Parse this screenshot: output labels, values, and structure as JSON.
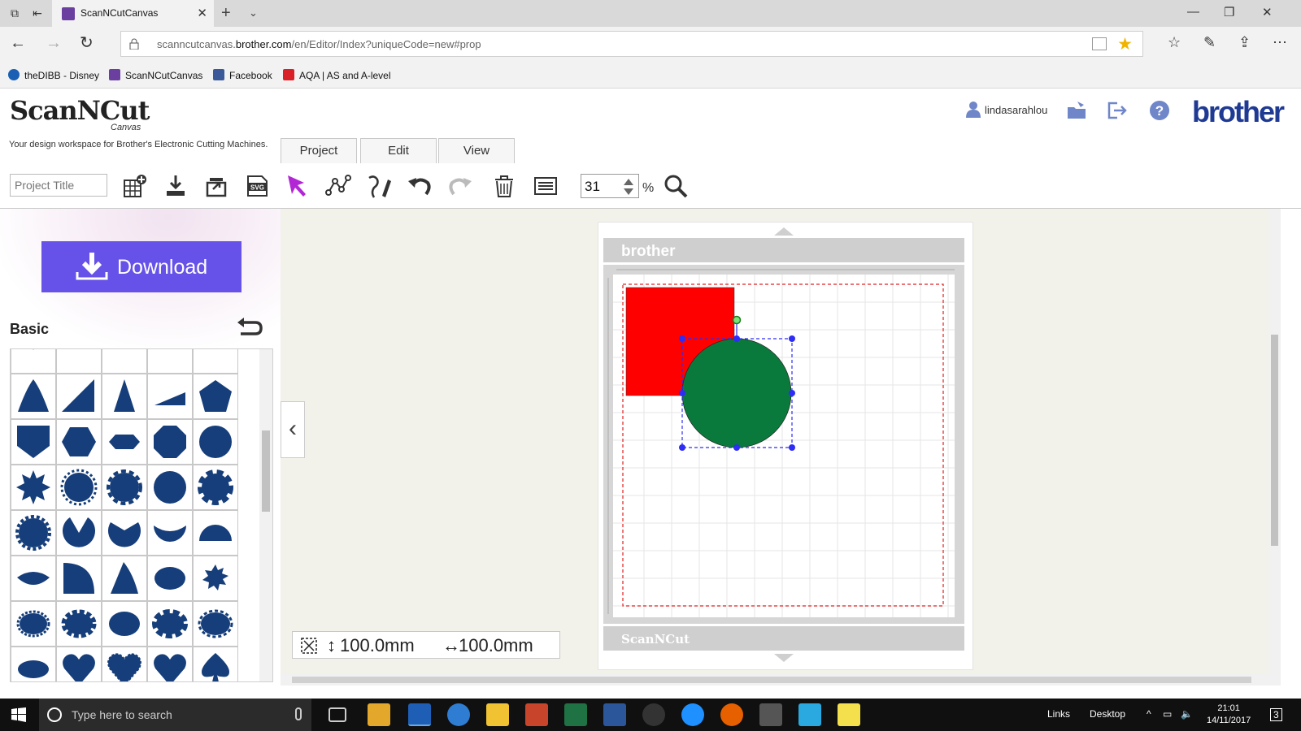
{
  "browser": {
    "tab_title": "ScanNCutCanvas",
    "url_prefix": "scanncutcanvas.",
    "url_domain": "brother.com",
    "url_path": "/en/Editor/Index?uniqueCode=new#prop",
    "favorites": [
      {
        "label": "theDIBB - Disney",
        "color": "#1a5fb4"
      },
      {
        "label": "ScanNCutCanvas",
        "color": "#6b3fa0"
      },
      {
        "label": "Facebook",
        "color": "#3b5998"
      },
      {
        "label": "AQA | AS and A-level",
        "color": "#d92027"
      }
    ]
  },
  "app": {
    "logo_text": "ScanNCut",
    "logo_sub": "Canvas",
    "tagline": "Your design workspace for Brother's Electronic Cutting Machines.",
    "menu_tabs": [
      "Project",
      "Edit",
      "View"
    ],
    "username": "lindasarahlou",
    "brand": "brother"
  },
  "toolbar": {
    "project_title_placeholder": "Project Title",
    "zoom_value": "31",
    "zoom_unit": "%",
    "tools": [
      "new-grid-icon",
      "import-icon",
      "export-icon",
      "svg-icon",
      "select-arrow-icon",
      "node-edit-icon",
      "pen-icon",
      "undo-icon",
      "redo-icon",
      "trash-icon",
      "list-icon"
    ]
  },
  "left_panel": {
    "download_label": "Download",
    "category_title": "Basic"
  },
  "canvas": {
    "mat_brand": "brother",
    "mat_footer": "ScanNCut",
    "shape_height": "100.0mm",
    "shape_width": "100.0mm",
    "selection_color": "#2d2df5",
    "square_color": "#ff0000",
    "circle_color": "#0a7a3c"
  },
  "taskbar": {
    "search_placeholder": "Type here to search",
    "links_label": "Links",
    "desktop_label": "Desktop",
    "time": "21:01",
    "date": "14/11/2017",
    "notification_count": "3"
  }
}
